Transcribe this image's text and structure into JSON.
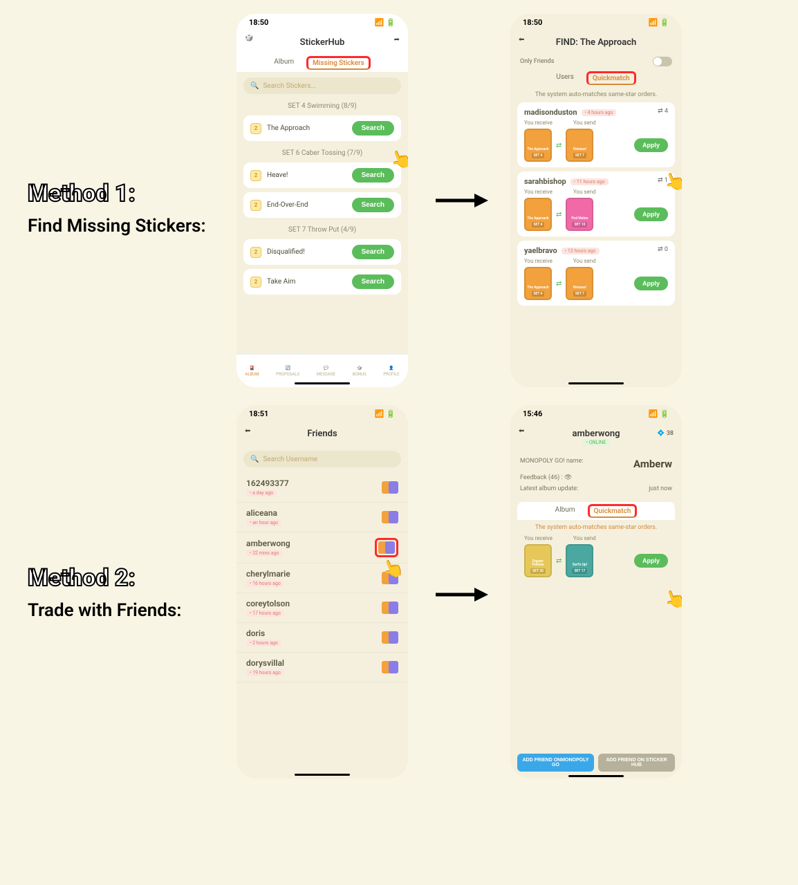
{
  "methods": {
    "m1": {
      "title": "Method 1:",
      "sub": "Find Missing Stickers:"
    },
    "m2": {
      "title": "Method 2:",
      "sub": "Trade with Friends:"
    }
  },
  "phone_a": {
    "time": "18:50",
    "title": "StickerHub",
    "tabs": {
      "album": "Album",
      "missing": "Missing Stickers"
    },
    "search_ph": "Search Stickers...",
    "sets": [
      {
        "header": "SET 4 Swimming (8/9)",
        "rows": [
          {
            "star": "2",
            "name": "The Approach",
            "btn": "Search"
          }
        ]
      },
      {
        "header": "SET 6 Caber Tossing (7/9)",
        "rows": [
          {
            "star": "2",
            "name": "Heave!",
            "btn": "Search"
          },
          {
            "star": "2",
            "name": "End-Over-End",
            "btn": "Search"
          }
        ]
      },
      {
        "header": "SET 7 Throw Put (4/9)",
        "rows": [
          {
            "star": "2",
            "name": "Disqualified!",
            "btn": "Search"
          },
          {
            "star": "2",
            "name": "Take Aim",
            "btn": "Search"
          }
        ]
      }
    ],
    "nav": {
      "album": "ALBUM",
      "proposals": "PROPOSALS",
      "message": "MESSAGE",
      "bonus": "BONUS",
      "profile": "PROFILE"
    }
  },
  "phone_b": {
    "time": "18:50",
    "title": "FIND: The Approach",
    "only_friends": "Only Friends",
    "tabs": {
      "users": "Users",
      "quick": "Quickmatch"
    },
    "info": "The system auto-matches same-star orders.",
    "recv": "You receive",
    "send": "You send",
    "apply": "Apply",
    "matches": [
      {
        "user": "madisonduston",
        "time": "4 hours ago",
        "count": "4",
        "recv_name": "The Approach",
        "recv_set": "SET 4",
        "recv_color": "#f2a13c",
        "send_name": "Release!",
        "send_set": "SET 7",
        "send_color": "#f2a13c"
      },
      {
        "user": "sarahbishop",
        "time": "11 hours ago",
        "count": "1",
        "recv_name": "The Approach",
        "recv_set": "SET 4",
        "recv_color": "#f2a13c",
        "send_name": "Pod Mates",
        "send_set": "SET 10",
        "send_color": "#f06aa8"
      },
      {
        "user": "yaelbravo",
        "time": "13 hours ago",
        "count": "0",
        "recv_name": "The Approach",
        "recv_set": "SET 4",
        "recv_color": "#f2a13c",
        "send_name": "Release!",
        "send_set": "SET 7",
        "send_color": "#f2a13c"
      }
    ]
  },
  "phone_c": {
    "time": "18:51",
    "title": "Friends",
    "search_ph": "Search Username",
    "friends": [
      {
        "name": "162493377",
        "time": "a day ago"
      },
      {
        "name": "aliceana",
        "time": "an hour ago"
      },
      {
        "name": "amberwong",
        "time": "32 mins ago"
      },
      {
        "name": "cherylmarie",
        "time": "16 hours ago"
      },
      {
        "name": "coreytolson",
        "time": "17 hours ago"
      },
      {
        "name": "doris",
        "time": "2 hours ago"
      },
      {
        "name": "dorysvillal",
        "time": "19 hours ago"
      }
    ]
  },
  "phone_d": {
    "time": "15:46",
    "user": "amberwong",
    "status": "ONLINE",
    "coin": "38",
    "mgo_label": "MONOPOLY GO!  name:",
    "mgo_name": "Amberw",
    "feedback_label": "Feedback (46) :",
    "latest_label": "Latest album update:",
    "latest_val": "just now",
    "tabs": {
      "album": "Album",
      "quick": "Quickmatch"
    },
    "info": "The system auto-matches same-star orders.",
    "recv": "You receive",
    "send": "You send",
    "apply": "Apply",
    "match": {
      "recv_name": "Dapper Fellows",
      "recv_set": "SET 20",
      "recv_color": "#e6c85a",
      "send_name": "Surf's Up!",
      "send_set": "SET 17",
      "send_color": "#4aa8a0"
    },
    "btn_blue": "ADD FRIEND ONMONOPOLY GO",
    "btn_grey": "ADD FRIEND ON STICKER HUB"
  }
}
